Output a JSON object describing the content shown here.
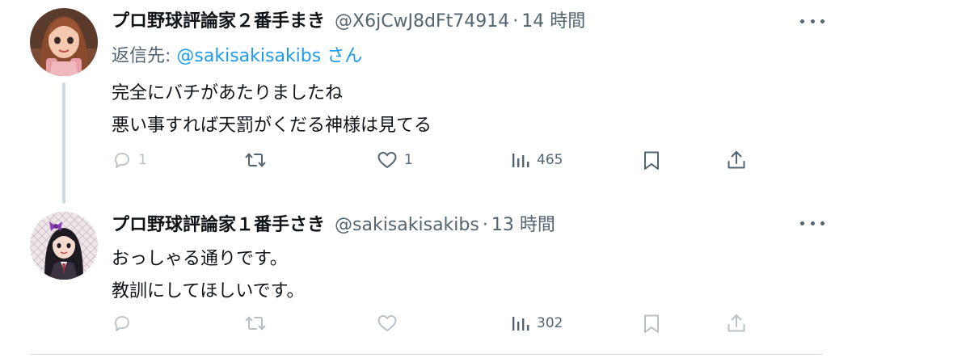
{
  "tweet1": {
    "display_name": "プロ野球評論家２番手まき",
    "handle": "@X6jCwJ8dFt74914",
    "separator": "·",
    "time": "14 時間",
    "reply_prefix": "返信先: ",
    "reply_mention": "@sakisakisakibs",
    "reply_suffix": " さん",
    "text_lines": [
      "完全にバチがあたりましたね",
      "悪い事すれば天罰がくだる神様は見てる"
    ],
    "reply_count": "1",
    "retweet_count": "",
    "like_count": "1",
    "view_count": "465"
  },
  "tweet2": {
    "display_name": "プロ野球評論家１番手さき",
    "handle": "@sakisakisakibs",
    "separator": "·",
    "time": "13 時間",
    "text_lines": [
      "おっしゃる通りです。",
      "教訓にしてほしいです。"
    ],
    "view_count": "302"
  },
  "icons": {
    "reply": "reply-icon",
    "retweet": "retweet-icon",
    "like": "heart-icon",
    "views": "views-chart-icon",
    "bookmark": "bookmark-icon",
    "share": "share-icon",
    "more": "more-dots-icon"
  },
  "colors": {
    "text": "#0f1419",
    "secondary": "#536471",
    "mention": "#1d9bf0",
    "faded_icon": "#b8c0c6",
    "thread_line": "#cfd9de"
  }
}
